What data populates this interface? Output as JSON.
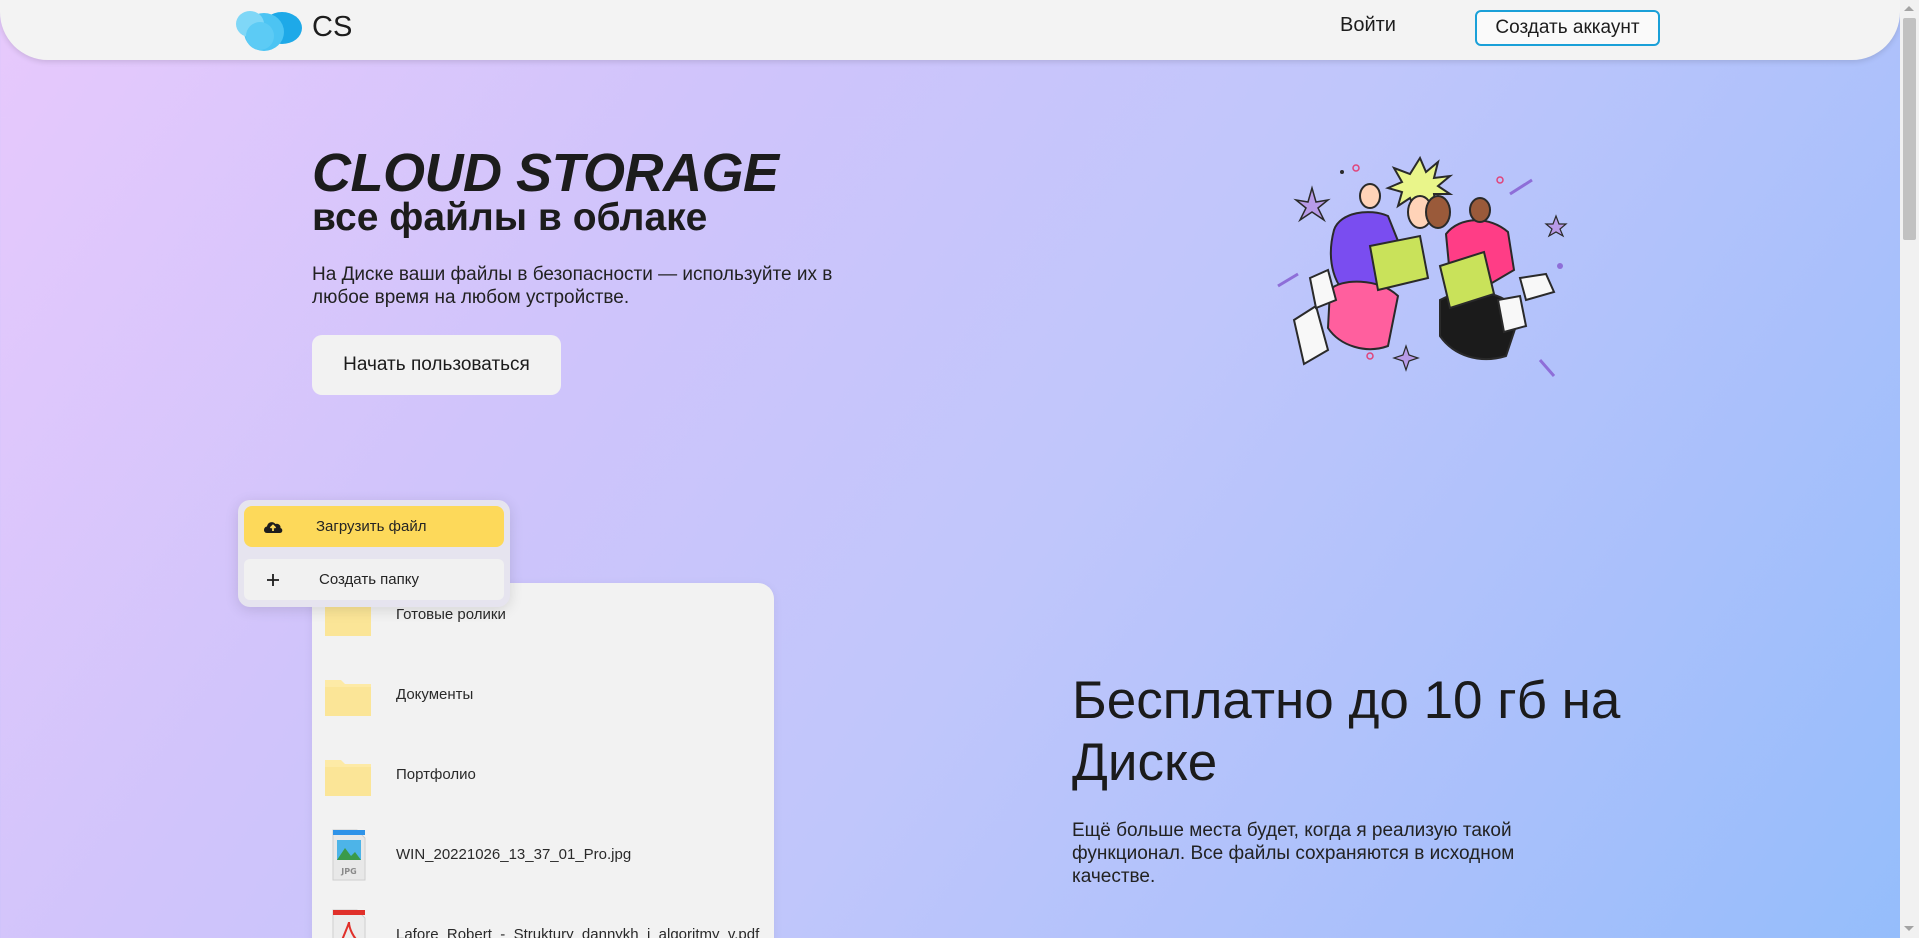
{
  "header": {
    "brand": "CS",
    "login_label": "Войти",
    "signup_label": "Создать аккаунт"
  },
  "hero": {
    "title": "CLOUD STORAGE",
    "subtitle": "все файлы в облаке",
    "description": "На Диске ваши файлы в безопасности — используйте их в любое время на любом устройстве.",
    "cta_label": "Начать пользоваться"
  },
  "menu": {
    "upload_label": "Загрузить файл",
    "create_label": "Создать папку"
  },
  "files": [
    {
      "name": "Готовые ролики",
      "type": "folder"
    },
    {
      "name": "Документы",
      "type": "folder"
    },
    {
      "name": "Портфолио",
      "type": "folder"
    },
    {
      "name": "WIN_20221026_13_37_01_Pro.jpg",
      "type": "jpg",
      "badge": "JPG"
    },
    {
      "name": "Lafore_Robert_-_Struktury_dannykh_i_algoritmy_v.pdf",
      "type": "pdf"
    }
  ],
  "promo": {
    "title": "Бесплатно до 10 гб на Диске",
    "description": "Ещё больше места будет, когда я реализую такой функционал. Все файлы сохраняются в исходном качестве."
  },
  "colors": {
    "accent_border": "#1aa0d8",
    "upload_bg": "#fdd95a",
    "folder": "#fdeaa6"
  },
  "icons": {
    "logo": "cloud-logo-icon",
    "upload": "cloud-upload-icon",
    "create": "plus-icon",
    "folder": "folder-icon",
    "jpg": "jpg-file-icon",
    "pdf": "pdf-file-icon"
  }
}
